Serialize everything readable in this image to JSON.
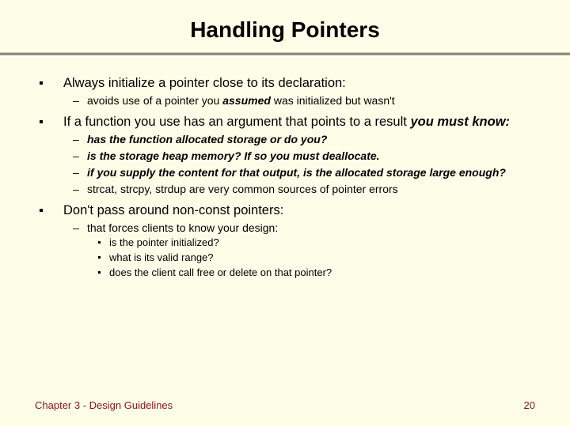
{
  "title": "Handling Pointers",
  "b1": "Always initialize a pointer close to its declaration:",
  "b1s1_a": "avoids use of a pointer you ",
  "b1s1_b": "assumed",
  "b1s1_c": " was initialized but wasn't",
  "b2_a": "If a function you use has an argument that points to a result ",
  "b2_b": "you must know:",
  "b2s1": "has the function allocated storage or do you?",
  "b2s2": "is the storage heap memory?  If so you must deallocate.",
  "b2s3": "if you supply the content for that output, is the allocated storage large enough?",
  "b2s4": "strcat, strcpy, strdup are very common sources of pointer errors",
  "b3": "Don't pass around non-const pointers:",
  "b3s1": "that forces clients to know your design:",
  "b3s1a": "is the pointer initialized?",
  "b3s1b": "what is its valid range?",
  "b3s1c": "does the client call free or delete on that pointer?",
  "footer_left": "Chapter 3 - Design Guidelines",
  "footer_right": "20"
}
